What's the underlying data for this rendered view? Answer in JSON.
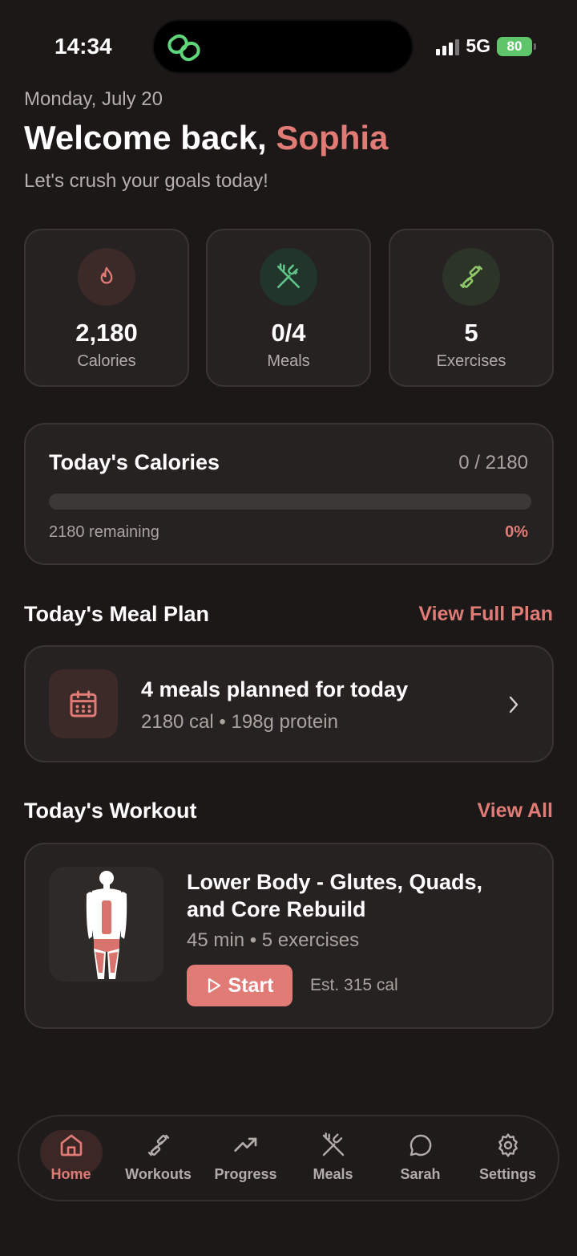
{
  "status_bar": {
    "time": "14:34",
    "network": "5G",
    "battery": "80"
  },
  "header": {
    "date": "Monday, July 20",
    "welcome_prefix": "Welcome back, ",
    "user_name": "Sophia",
    "subtitle": "Let's crush your goals today!"
  },
  "stats": [
    {
      "value": "2,180",
      "label": "Calories",
      "icon": "flame-icon",
      "color": "#e07b76"
    },
    {
      "value": "0/4",
      "label": "Meals",
      "icon": "utensils-crossed-icon",
      "color": "#5fc58a"
    },
    {
      "value": "5",
      "label": "Exercises",
      "icon": "dumbbell-icon",
      "color": "#8fc86a"
    }
  ],
  "calories": {
    "title": "Today's Calories",
    "count": "0 / 2180",
    "remaining": "2180 remaining",
    "percent_label": "0%",
    "progress": 0
  },
  "meal_plan": {
    "section_title": "Today's Meal Plan",
    "link": "View Full Plan",
    "title": "4 meals planned for today",
    "subtitle": "2180 cal • 198g protein"
  },
  "workout": {
    "section_title": "Today's Workout",
    "link": "View All",
    "title": "Lower Body - Glutes, Quads, and Core Rebuild",
    "subtitle": "45 min • 5 exercises",
    "start_label": "Start",
    "estimate": "Est. 315 cal"
  },
  "nav": {
    "active": "Home",
    "items": [
      {
        "label": "Home",
        "icon": "home-icon"
      },
      {
        "label": "Workouts",
        "icon": "dumbbell-icon"
      },
      {
        "label": "Progress",
        "icon": "trending-up-icon"
      },
      {
        "label": "Meals",
        "icon": "utensils-crossed-icon"
      },
      {
        "label": "Sarah",
        "icon": "chat-bubble-icon"
      },
      {
        "label": "Settings",
        "icon": "gear-icon"
      }
    ]
  },
  "colors": {
    "accent": "#e07b76",
    "background": "#1b1817",
    "card": "#262221",
    "success": "#5fc56a"
  }
}
